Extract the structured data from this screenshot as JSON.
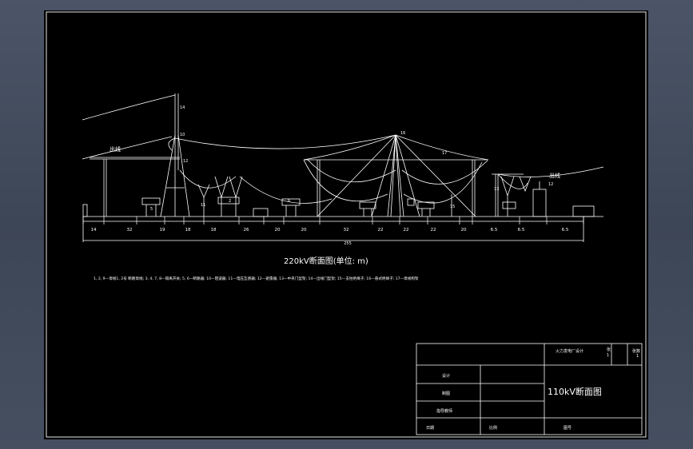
{
  "drawing": {
    "section_title": "220kV断面图(单位: m)",
    "outgoing_label_left": "出线",
    "outgoing_label_right": "出线",
    "dimensions": [
      "14",
      "32",
      "19",
      "18",
      "18",
      "26",
      "20",
      "20",
      "32",
      "22",
      "22",
      "22",
      "20",
      "6.5",
      "6.5",
      "6.5"
    ],
    "overall_dimension": "255",
    "legend": "1, 2, 9—母线1, 2号 断路母线; 3, 4, 7, 8—隔离开关; 5, 6—断路器; 10—阻波器; 11—电压互感器; 12—避雷器; 13—中央门型架; 14—出线门型架; 15—支柱绝缘子; 16—悬式绝缘子; 17—母线构架",
    "component_labels": [
      "14",
      "16",
      "10",
      "12",
      "17",
      "13",
      "15",
      "11",
      "2",
      "5",
      "6",
      "12"
    ]
  },
  "title_block": {
    "design_name": "火力发电厂设计",
    "sheet_no_label": "张",
    "sheet_no": "1",
    "sheet_label": "张数",
    "sheet_count": "1",
    "designed_by": "设计",
    "drawn_by": "制图",
    "instructor": "指导教师",
    "date_label": "日期",
    "scale_label": "比例",
    "drawing_title": "110kV断面图",
    "drawing_no_label": "图号"
  }
}
